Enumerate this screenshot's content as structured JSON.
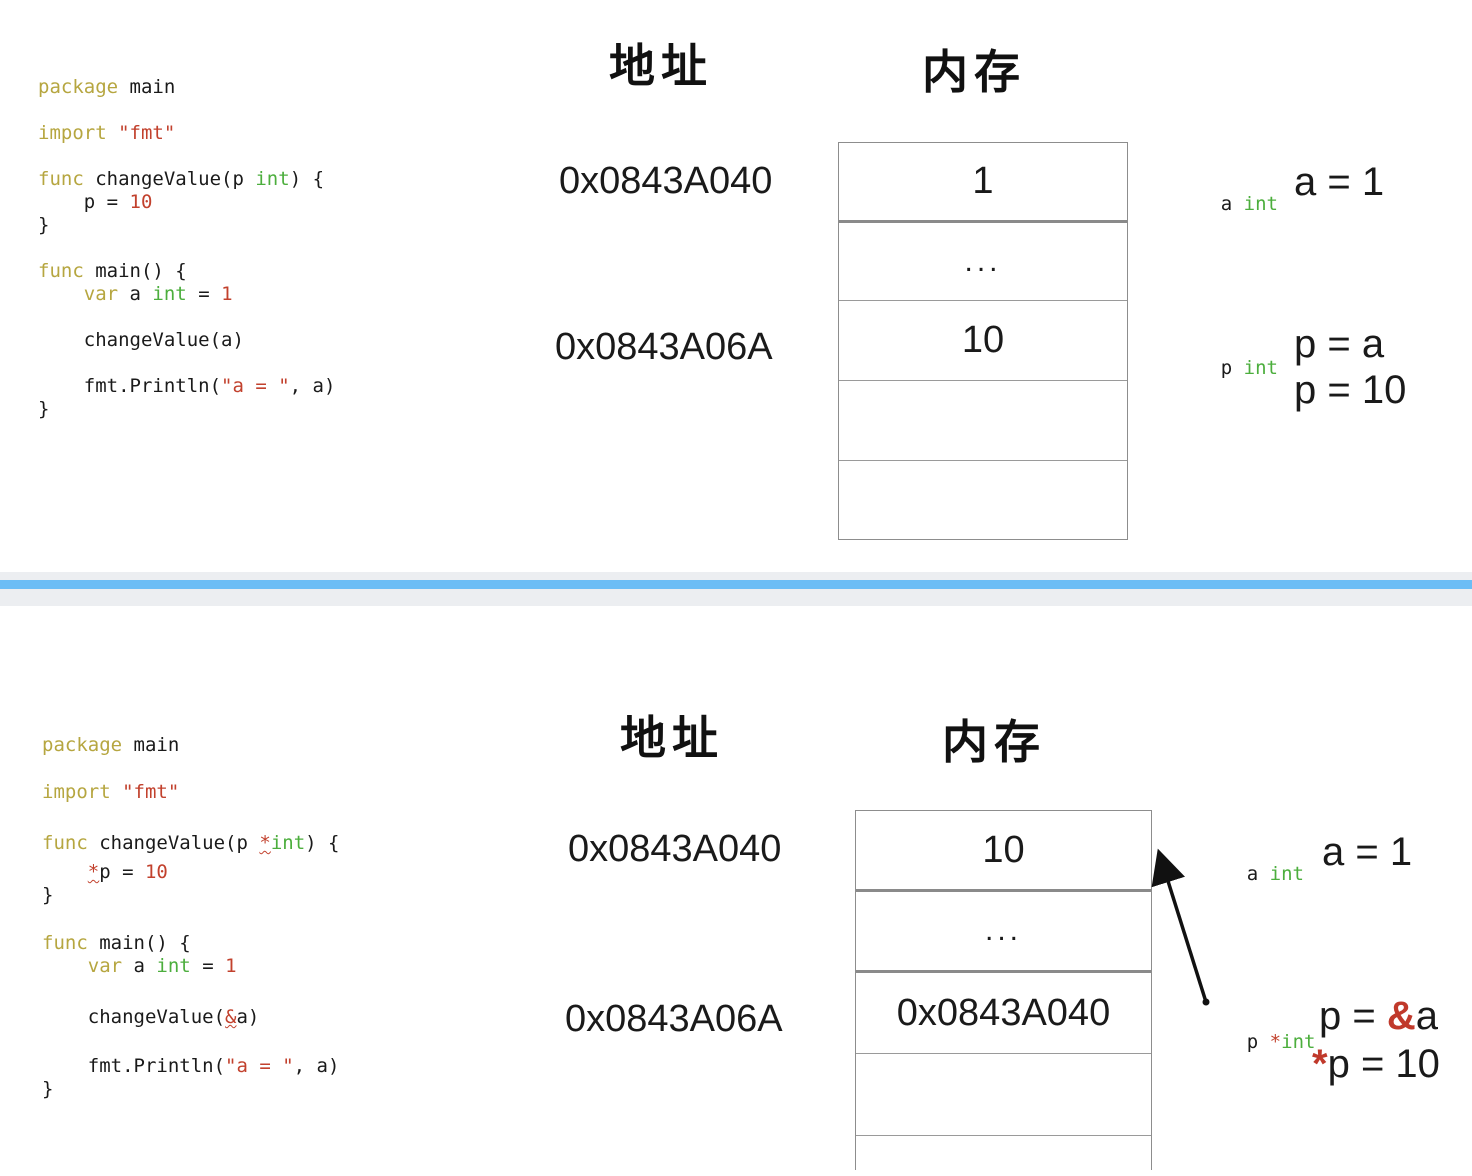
{
  "top": {
    "code_lines": [
      [
        {
          "t": "package",
          "c": "kw"
        },
        {
          "t": " main",
          "c": ""
        }
      ],
      [
        {
          "t": "import",
          "c": "kw"
        },
        {
          "t": " \"fmt\"",
          "c": "str"
        }
      ],
      [
        {
          "t": "func",
          "c": "kw"
        },
        {
          "t": " changeValue(p ",
          "c": ""
        },
        {
          "t": "int",
          "c": "ty"
        },
        {
          "t": ") {",
          "c": ""
        }
      ],
      [
        {
          "t": "    p = ",
          "c": ""
        },
        {
          "t": "10",
          "c": "num"
        }
      ],
      [
        {
          "t": "}",
          "c": ""
        }
      ],
      [
        {
          "t": "func",
          "c": "kw"
        },
        {
          "t": " main() {",
          "c": ""
        }
      ],
      [
        {
          "t": "    ",
          "c": ""
        },
        {
          "t": "var",
          "c": "kw"
        },
        {
          "t": " a ",
          "c": ""
        },
        {
          "t": "int",
          "c": "ty"
        },
        {
          "t": " = ",
          "c": ""
        },
        {
          "t": "1",
          "c": "num"
        }
      ],
      [
        {
          "t": "    changeValue(a)",
          "c": ""
        }
      ],
      [
        {
          "t": "    fmt.Println(",
          "c": ""
        },
        {
          "t": "\"a = \"",
          "c": "str"
        },
        {
          "t": ", a)",
          "c": ""
        }
      ],
      [
        {
          "t": "}",
          "c": ""
        }
      ]
    ],
    "heading_address": "地址",
    "heading_memory": "内存",
    "address_1": "0x0843A040",
    "address_2": "0x0843A06A",
    "cells": [
      "1",
      "...",
      "10",
      "",
      ""
    ],
    "var_a_name": "a",
    "var_a_type": "int",
    "var_p_name": "p",
    "var_p_type": "int",
    "note_a": "a = 1",
    "note_p1": "p = a",
    "note_p2": "p = 10"
  },
  "bottom": {
    "code_lines": [
      [
        {
          "t": "package",
          "c": "kw"
        },
        {
          "t": " main",
          "c": ""
        }
      ],
      [
        {
          "t": "import",
          "c": "kw"
        },
        {
          "t": " \"fmt\"",
          "c": "str"
        }
      ],
      [
        {
          "t": "func",
          "c": "kw"
        },
        {
          "t": " changeValue(p ",
          "c": ""
        },
        {
          "t": "*",
          "c": "op"
        },
        {
          "t": "int",
          "c": "ty"
        },
        {
          "t": ") {",
          "c": ""
        }
      ],
      [
        {
          "t": "    ",
          "c": ""
        },
        {
          "t": "*",
          "c": "op"
        },
        {
          "t": "p = ",
          "c": ""
        },
        {
          "t": "10",
          "c": "num"
        }
      ],
      [
        {
          "t": "}",
          "c": ""
        }
      ],
      [
        {
          "t": "func",
          "c": "kw"
        },
        {
          "t": " main() {",
          "c": ""
        }
      ],
      [
        {
          "t": "    ",
          "c": ""
        },
        {
          "t": "var",
          "c": "kw"
        },
        {
          "t": " a ",
          "c": ""
        },
        {
          "t": "int",
          "c": "ty"
        },
        {
          "t": " = ",
          "c": ""
        },
        {
          "t": "1",
          "c": "num"
        }
      ],
      [
        {
          "t": "    changeValue(",
          "c": ""
        },
        {
          "t": "&",
          "c": "op"
        },
        {
          "t": "a)",
          "c": ""
        }
      ],
      [
        {
          "t": "    fmt.Println(",
          "c": ""
        },
        {
          "t": "\"a = \"",
          "c": "str"
        },
        {
          "t": ", a)",
          "c": ""
        }
      ],
      [
        {
          "t": "}",
          "c": ""
        }
      ]
    ],
    "heading_address": "地址",
    "heading_memory": "内存",
    "address_1": "0x0843A040",
    "address_2": "0x0843A06A",
    "cells": [
      "10",
      "...",
      "0x0843A040",
      "",
      ""
    ],
    "var_a_name": "a",
    "var_a_type": "int",
    "var_p_name": "p",
    "var_p_star": "*",
    "var_p_type": "int",
    "note_a": "a = 1",
    "note_p1_prefix": "p = ",
    "note_p1_amp": "&",
    "note_p1_suffix": "a",
    "note_p2_star": "*",
    "note_p2_suffix": "p = 10"
  },
  "colors": {
    "keyword": "#b6a640",
    "type": "#4cae3d",
    "literal": "#c2412d",
    "separator": "#6cbdf5"
  }
}
